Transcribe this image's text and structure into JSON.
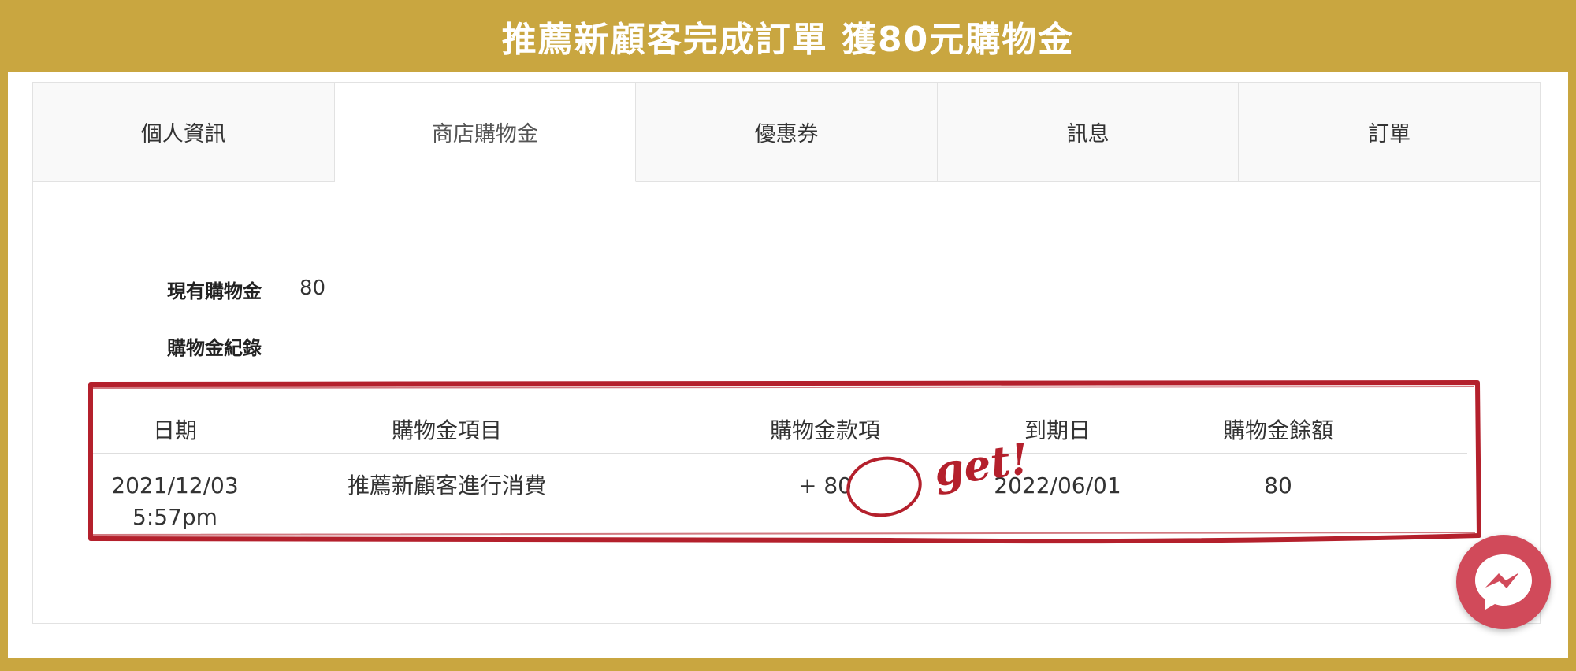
{
  "banner": {
    "title": "推薦新顧客完成訂單 獲80元購物金"
  },
  "tabs": [
    {
      "label": "個人資訊"
    },
    {
      "label": "商店購物金"
    },
    {
      "label": "優惠券"
    },
    {
      "label": "訊息"
    },
    {
      "label": "訂單"
    }
  ],
  "active_tab": "商店購物金",
  "balance": {
    "label": "現有購物金",
    "value": "80"
  },
  "history": {
    "label": "購物金紀錄",
    "columns": [
      "日期",
      "購物金項目",
      "購物金款項",
      "到期日",
      "購物金餘額"
    ],
    "rows": [
      {
        "date": "2021/12/03 5:57pm",
        "item": "推薦新顧客進行消費",
        "amount": "+ 80",
        "expiry": "2022/06/01",
        "balance": "80"
      }
    ]
  },
  "annotation": {
    "text": "get!",
    "color": "#b4202c"
  },
  "colors": {
    "frame": "#c9a640",
    "marker": "#b4202c",
    "messenger": "#d14a5a"
  },
  "icons": {
    "chat": "messenger-icon"
  }
}
